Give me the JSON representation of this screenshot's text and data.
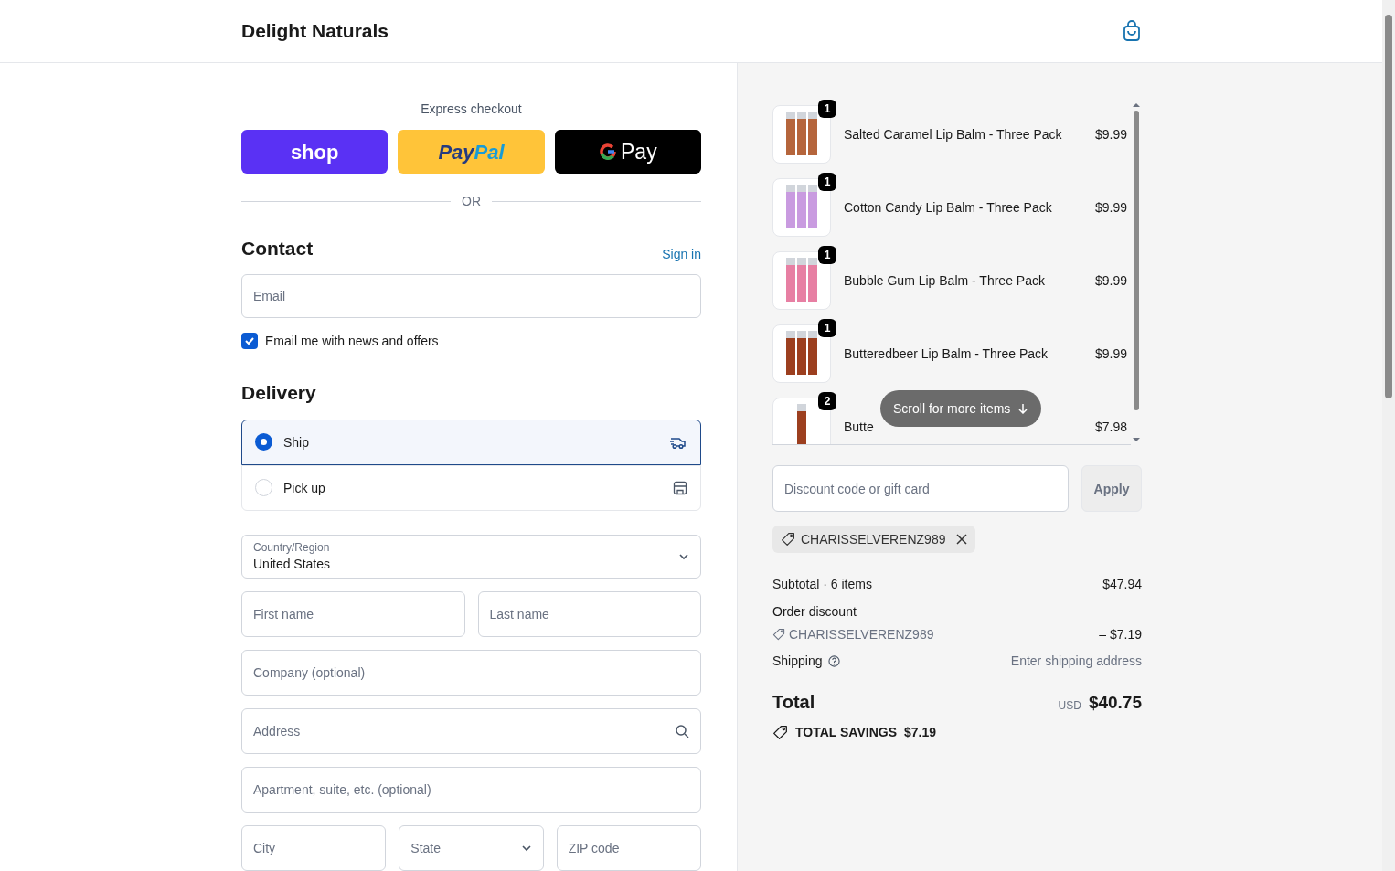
{
  "header": {
    "brand": "Delight Naturals"
  },
  "express": {
    "title": "Express checkout",
    "buttons": [
      {
        "kind": "shop",
        "parts": [
          "shop"
        ]
      },
      {
        "kind": "paypal",
        "parts": [
          "Pay",
          "Pal"
        ]
      },
      {
        "kind": "gpay",
        "parts": [
          "Pay"
        ]
      }
    ],
    "divider": "OR"
  },
  "contact": {
    "title": "Contact",
    "sign_in": "Sign in",
    "email_placeholder": "Email",
    "newsletter": {
      "label": "Email me with news and offers",
      "checked": true
    }
  },
  "delivery": {
    "title": "Delivery",
    "options": [
      {
        "label": "Ship",
        "kind": "ship",
        "selected": true
      },
      {
        "label": "Pick up",
        "kind": "pickup",
        "selected": false
      }
    ]
  },
  "address": {
    "country": {
      "label": "Country/Region",
      "value": "United States"
    },
    "rows": [
      [
        {
          "placeholder": "First name",
          "kind": "text"
        },
        {
          "placeholder": "Last name",
          "kind": "text"
        }
      ],
      [
        {
          "placeholder": "Company (optional)",
          "kind": "text"
        }
      ],
      [
        {
          "placeholder": "Address",
          "kind": "search"
        }
      ],
      [
        {
          "placeholder": "Apartment, suite, etc. (optional)",
          "kind": "text"
        }
      ],
      [
        {
          "placeholder": "City",
          "kind": "text"
        },
        {
          "placeholder": "State",
          "kind": "select"
        },
        {
          "placeholder": "ZIP code",
          "kind": "text"
        }
      ]
    ]
  },
  "cart": {
    "items": [
      {
        "qty": "1",
        "name": "Salted Caramel Lip Balm - Three Pack",
        "price": "$9.99",
        "color": "#b5653c",
        "kind": "pack"
      },
      {
        "qty": "1",
        "name": "Cotton Candy Lip Balm - Three Pack",
        "price": "$9.99",
        "color": "#c99be0",
        "kind": "pack"
      },
      {
        "qty": "1",
        "name": "Bubble Gum Lip Balm - Three Pack",
        "price": "$9.99",
        "color": "#e77fa3",
        "kind": "pack"
      },
      {
        "qty": "1",
        "name": "Butteredbeer Lip Balm - Three Pack",
        "price": "$9.99",
        "color": "#9c3f1f",
        "kind": "pack"
      },
      {
        "qty": "2",
        "name": "Butte",
        "price": "$7.98",
        "color": "#9c3f1f",
        "kind": "single"
      }
    ],
    "scroll_hint": "Scroll for more items"
  },
  "discount": {
    "placeholder": "Discount code or gift card",
    "apply": "Apply",
    "applied_code": "CHARISSELVERENZ989"
  },
  "summary": {
    "subtotal_label": "Subtotal · 6 items",
    "subtotal": "$47.94",
    "discount_label": "Order discount",
    "discount_code": "CHARISSELVERENZ989",
    "discount": "– $7.19",
    "shipping_label": "Shipping",
    "shipping": "Enter shipping address",
    "total_label": "Total",
    "currency": "USD",
    "total": "$40.75",
    "savings_label": "TOTAL SAVINGS",
    "savings": "$7.19"
  }
}
